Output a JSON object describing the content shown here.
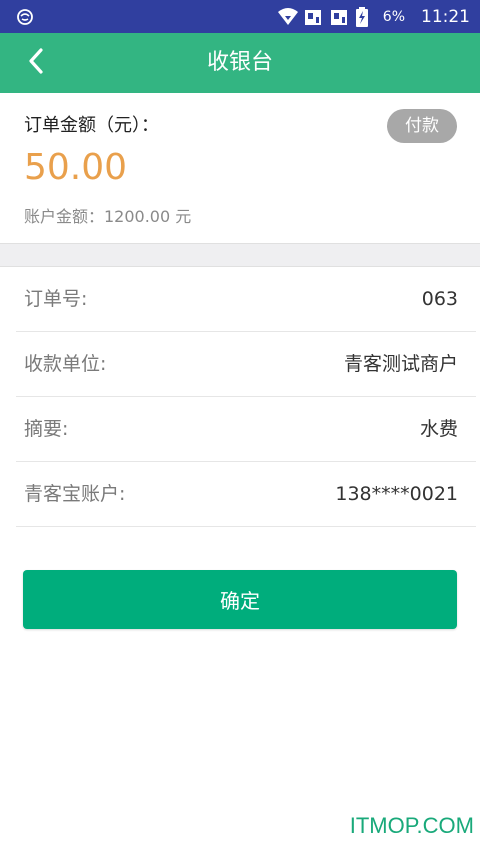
{
  "status_bar": {
    "battery_pct": "6%",
    "time": "11:21"
  },
  "app_bar": {
    "title": "收银台"
  },
  "order": {
    "amount_label": "订单金额（元）：",
    "pay_badge": "付款",
    "amount": "50.00",
    "balance": "账户金额：1200.00 元"
  },
  "details": [
    {
      "label": "订单号:",
      "value": "063"
    },
    {
      "label": "收款单位:",
      "value": "青客测试商户"
    },
    {
      "label": "摘要:",
      "value": "水费"
    },
    {
      "label": "青客宝账户:",
      "value": "138****0021"
    }
  ],
  "confirm_label": "确定",
  "watermark": "ITMOP.COM",
  "colors": {
    "status_bar": "#303f9f",
    "app_bar": "#33b582",
    "amount": "#e9a04c",
    "confirm_button": "#00ad7c",
    "pay_badge": "#a8a8a8",
    "watermark": "#19a97a"
  }
}
